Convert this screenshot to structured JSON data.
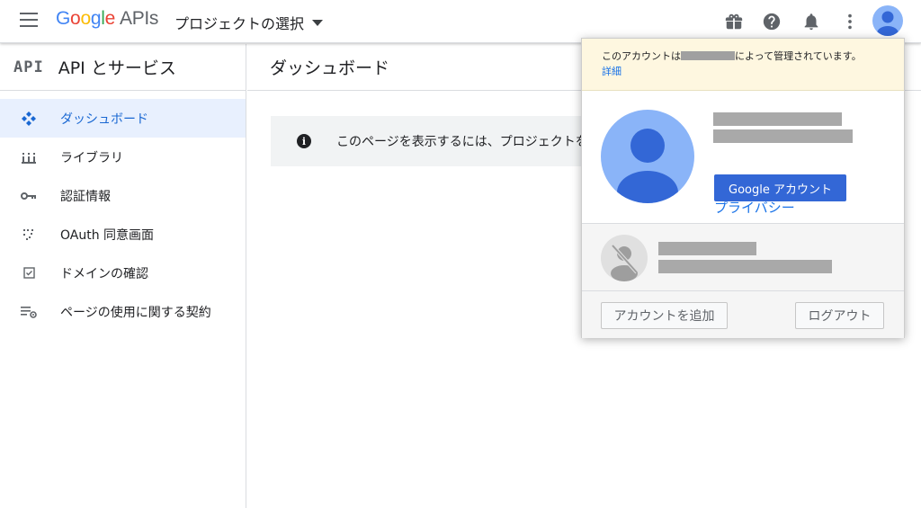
{
  "header": {
    "logo_google": [
      "G",
      "o",
      "o",
      "g",
      "l",
      "e"
    ],
    "logo_apis": "APIs",
    "project_select_label": "プロジェクトの選択",
    "icons": [
      "menu-icon",
      "gift-icon",
      "help-icon",
      "bell-icon",
      "more-vert-icon",
      "account-avatar"
    ]
  },
  "sidebar": {
    "badge": "API",
    "title": "API とサービス",
    "items": [
      {
        "label": "ダッシュボード",
        "icon": "dashboard-icon",
        "active": true
      },
      {
        "label": "ライブラリ",
        "icon": "library-icon",
        "active": false
      },
      {
        "label": "認証情報",
        "icon": "key-icon",
        "active": false
      },
      {
        "label": "OAuth 同意画面",
        "icon": "oauth-icon",
        "active": false
      },
      {
        "label": "ドメインの確認",
        "icon": "checkbox-icon",
        "active": false
      },
      {
        "label": "ページの使用に関する契約",
        "icon": "settings-list-icon",
        "active": false
      }
    ]
  },
  "main": {
    "title": "ダッシュボード",
    "info_text": "このページを表示するには、プロジェクトを"
  },
  "account_popup": {
    "notice_prefix": "このアカウントは",
    "notice_suffix": "によって管理されています。",
    "notice_link": "詳細",
    "privacy_link": "プライバシー",
    "google_account_button": "Google アカウント",
    "add_account_button": "アカウントを追加",
    "logout_button": "ログアウト"
  },
  "colors": {
    "accent_blue": "#1a73e8",
    "button_blue": "#3367d6",
    "active_nav_bg": "#e8f0fe",
    "notice_bg": "#fef7e0",
    "avatar_blue": "#8ab4f8"
  }
}
